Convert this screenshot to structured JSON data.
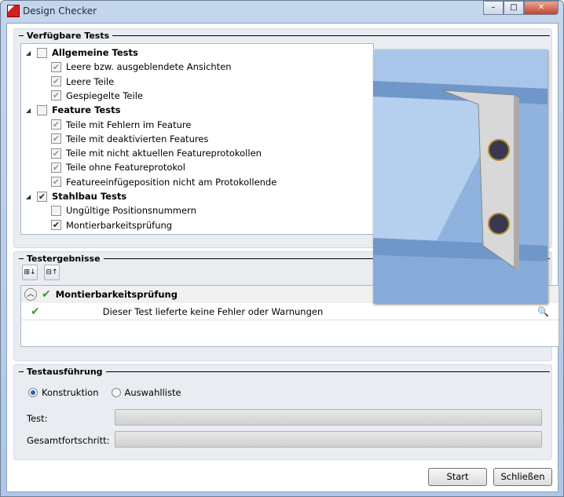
{
  "window": {
    "title": "Design Checker",
    "minimize": "–",
    "maximize": "□",
    "close": "✕"
  },
  "available": {
    "title": "Verfügbare Tests",
    "groups": [
      {
        "label": "Allgemeine Tests",
        "checked": false,
        "items": [
          {
            "label": "Leere bzw. ausgeblendete Ansichten",
            "checked": true,
            "disabled": true
          },
          {
            "label": "Leere Teile",
            "checked": true,
            "disabled": true
          },
          {
            "label": "Gespiegelte Teile",
            "checked": true,
            "disabled": true
          }
        ]
      },
      {
        "label": "Feature Tests",
        "checked": false,
        "items": [
          {
            "label": "Teile mit Fehlern im Feature",
            "checked": true,
            "disabled": true
          },
          {
            "label": "Teile mit deaktivierten Features",
            "checked": true,
            "disabled": true
          },
          {
            "label": "Teile mit nicht aktuellen Featureprotokollen",
            "checked": true,
            "disabled": true
          },
          {
            "label": "Teile ohne Featureprotokol",
            "checked": true,
            "disabled": true
          },
          {
            "label": "Featureeinfügeposition nicht am Protokollende",
            "checked": true,
            "disabled": true
          }
        ]
      },
      {
        "label": "Stahlbau Tests",
        "checked": true,
        "items": [
          {
            "label": "Ungültige Positionsnummern",
            "checked": false,
            "disabled": false
          },
          {
            "label": "Montierbarkeitsprüfung",
            "checked": true,
            "disabled": false
          }
        ]
      }
    ]
  },
  "results": {
    "title": "Testergebnisse",
    "header": "Montierbarkeitsprüfung",
    "message": "Dieser Test lieferte keine Fehler oder Warnungen"
  },
  "execution": {
    "title": "Testausführung",
    "radio1": "Konstruktion",
    "radio2": "Auswahlliste",
    "test_label": "Test:",
    "total_label": "Gesamtfortschritt:"
  },
  "buttons": {
    "start": "Start",
    "close": "Schließen"
  }
}
